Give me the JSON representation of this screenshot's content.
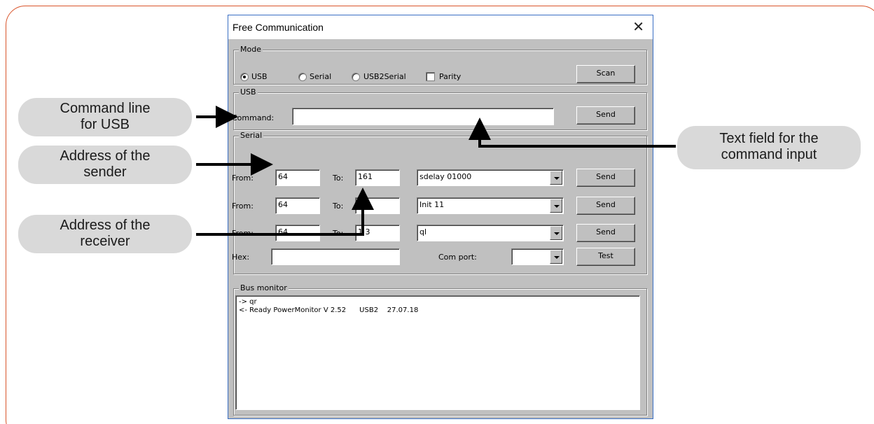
{
  "window": {
    "title": "Free Communication",
    "close_glyph": "✕"
  },
  "mode": {
    "group_label": "Mode",
    "radios": [
      {
        "label": "USB",
        "selected": true
      },
      {
        "label": "Serial",
        "selected": false
      },
      {
        "label": "USB2Serial",
        "selected": false
      }
    ],
    "parity_label": "Parity",
    "parity_checked": false,
    "scan_label": "Scan"
  },
  "usb": {
    "group_label": "USB",
    "command_label": "Command:",
    "command_value": "",
    "send_label": "Send"
  },
  "serial": {
    "group_label": "Serial",
    "rows": [
      {
        "from_label": "From:",
        "from_value": "64",
        "to_label": "To:",
        "to_value": "161",
        "command": "sdelay 01000",
        "send_label": "Send"
      },
      {
        "from_label": "From:",
        "from_value": "64",
        "to_label": "To:",
        "to_value": "1 8",
        "command": "Init 11",
        "send_label": "Send"
      },
      {
        "from_label": "From:",
        "from_value": "64",
        "to_label": "To:",
        "to_value": "1 3",
        "command": "ql",
        "send_label": "Send"
      }
    ],
    "hex_label": "Hex:",
    "hex_value": "",
    "comport_label": "Com port:",
    "comport_value": "",
    "test_label": "Test"
  },
  "bus_monitor": {
    "group_label": "Bus monitor",
    "lines": [
      "-> qr",
      "<- Ready PowerMonitor V 2.52      USB2    27.07.18"
    ]
  },
  "callouts": {
    "command_line": [
      "Command line",
      "for USB"
    ],
    "sender": [
      "Address of the",
      "sender"
    ],
    "receiver": [
      "Address of the",
      "receiver"
    ],
    "text_field": [
      "Text field for the",
      "command input"
    ]
  },
  "colors": {
    "frame": "#d9542b",
    "callout_bg": "#d9d9d9",
    "dialog_bg": "#c0c0c0",
    "title_border": "#3a6fc4"
  }
}
